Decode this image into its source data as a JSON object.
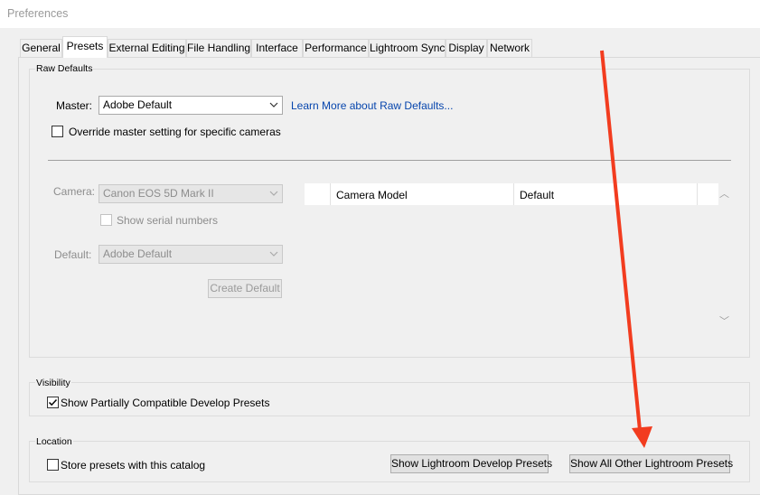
{
  "window": {
    "title": "Preferences"
  },
  "tabs": [
    {
      "label": "General",
      "active": false
    },
    {
      "label": "Presets",
      "active": true
    },
    {
      "label": "External Editing",
      "active": false
    },
    {
      "label": "File Handling",
      "active": false
    },
    {
      "label": "Interface",
      "active": false
    },
    {
      "label": "Performance",
      "active": false
    },
    {
      "label": "Lightroom Sync",
      "active": false
    },
    {
      "label": "Display",
      "active": false
    },
    {
      "label": "Network",
      "active": false
    }
  ],
  "raw_defaults": {
    "group_label": "Raw Defaults",
    "master_label": "Master:",
    "master_value": "Adobe Default",
    "learn_more_link": "Learn More about Raw Defaults...",
    "override_label": "Override master setting for specific cameras",
    "override_checked": false,
    "camera_label": "Camera:",
    "camera_value": "Canon EOS 5D Mark II",
    "serial_label": "Show serial numbers",
    "default_label": "Default:",
    "default_value": "Adobe Default",
    "create_default_button": "Create Default",
    "table": {
      "col_camera_model": "Camera Model",
      "col_default": "Default"
    }
  },
  "visibility": {
    "group_label": "Visibility",
    "show_partial_label": "Show Partially Compatible Develop Presets",
    "show_partial_checked": true
  },
  "location": {
    "group_label": "Location",
    "store_label": "Store presets with this catalog",
    "store_checked": false,
    "show_develop_button": "Show Lightroom Develop Presets",
    "show_other_button": "Show All Other Lightroom Presets"
  },
  "annotation": {
    "arrow_color": "#f23c1f"
  },
  "colors": {
    "link": "#0645ad",
    "disabled_text": "#8d8d8d"
  }
}
